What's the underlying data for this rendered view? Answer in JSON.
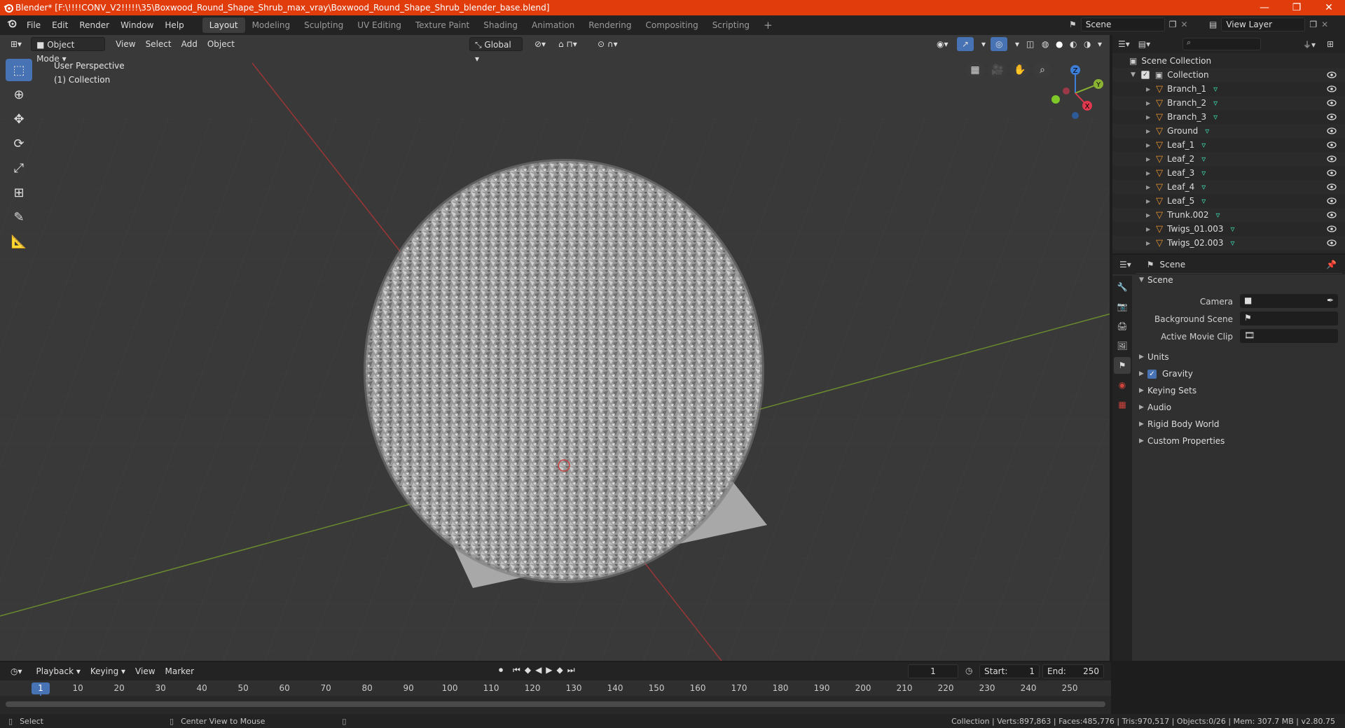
{
  "window": {
    "title": "Blender* [F:\\!!!!CONV_V2!!!!!\\35\\Boxwood_Round_Shape_Shrub_max_vray\\Boxwood_Round_Shape_Shrub_blender_base.blend]",
    "minimize": "—",
    "maximize": "❐",
    "close": "✕"
  },
  "menu": {
    "file": "File",
    "edit": "Edit",
    "render": "Render",
    "window": "Window",
    "help": "Help"
  },
  "workspaces": [
    "Layout",
    "Modeling",
    "Sculpting",
    "UV Editing",
    "Texture Paint",
    "Shading",
    "Animation",
    "Rendering",
    "Compositing",
    "Scripting"
  ],
  "scene_selector": {
    "value": "Scene"
  },
  "view_layer": {
    "value": "View Layer"
  },
  "viewport": {
    "mode": "Object Mode",
    "menus": {
      "view": "View",
      "select": "Select",
      "add": "Add",
      "object": "Object"
    },
    "transform_orientation": "Global",
    "info_line1": "User Perspective",
    "info_line2": "(1) Collection",
    "gizmo": {
      "z": "Z",
      "y": "Y",
      "x": "X"
    }
  },
  "outliner": {
    "search_placeholder": "",
    "scene_collection": "Scene Collection",
    "collection": "Collection",
    "items": [
      "Branch_1",
      "Branch_2",
      "Branch_3",
      "Ground",
      "Leaf_1",
      "Leaf_2",
      "Leaf_3",
      "Leaf_4",
      "Leaf_5",
      "Trunk.002",
      "Twigs_01.003",
      "Twigs_02.003"
    ]
  },
  "properties": {
    "context": "Scene",
    "panel_title": "Scene",
    "camera_label": "Camera",
    "background_scene_label": "Background Scene",
    "active_movie_clip_label": "Active Movie Clip",
    "panels": {
      "units": "Units",
      "gravity": "Gravity",
      "keying_sets": "Keying Sets",
      "audio": "Audio",
      "rigid_body_world": "Rigid Body World",
      "custom_properties": "Custom Properties"
    },
    "gravity_enabled": true
  },
  "timeline": {
    "menus": {
      "playback": "Playback",
      "keying": "Keying",
      "view": "View",
      "marker": "Marker"
    },
    "current_frame": "1",
    "start_label": "Start:",
    "start_value": "1",
    "end_label": "End:",
    "end_value": "250",
    "ruler": [
      "1",
      "10",
      "20",
      "30",
      "40",
      "50",
      "60",
      "70",
      "80",
      "90",
      "100",
      "110",
      "120",
      "130",
      "140",
      "150",
      "160",
      "170",
      "180",
      "190",
      "200",
      "210",
      "220",
      "230",
      "240",
      "250"
    ]
  },
  "status": {
    "left_action": "Select",
    "middle_action": "Center View to Mouse",
    "stats": "Collection | Verts:897,863 | Faces:485,776 | Tris:970,517 | Objects:0/26 | Mem: 307.7 MB | v2.80.75"
  }
}
